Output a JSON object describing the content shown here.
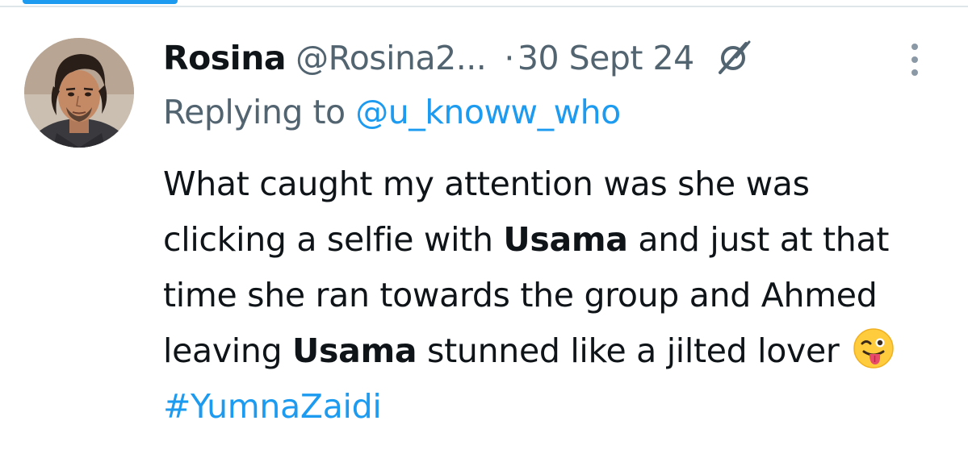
{
  "tweet": {
    "author_name": "Rosina",
    "author_handle": "@Rosina2...",
    "separator": "·",
    "date": "30 Sept 24",
    "replying_prefix": "Replying to",
    "replying_to": "@u_knoww_who",
    "text_segments": [
      {
        "text": "What caught my attention was she was clicking a selfie with ",
        "style": "normal"
      },
      {
        "text": "Usama",
        "style": "bold"
      },
      {
        "text": " and just at that time she ran towards the group and Ahmed leaving ",
        "style": "normal"
      },
      {
        "text": "Usama",
        "style": "bold"
      },
      {
        "text": " stunned like a jilted lover ",
        "style": "normal"
      },
      {
        "text": "#YumnaZaidi",
        "style": "hashtag"
      }
    ],
    "emoji": "winking-face-with-tongue",
    "icons": {
      "grok": "grok-icon",
      "more": "more-options-icon",
      "avatar": "avatar"
    }
  },
  "colors": {
    "text_primary": "#0f1419",
    "text_secondary": "#536471",
    "accent": "#1d9bf0"
  }
}
